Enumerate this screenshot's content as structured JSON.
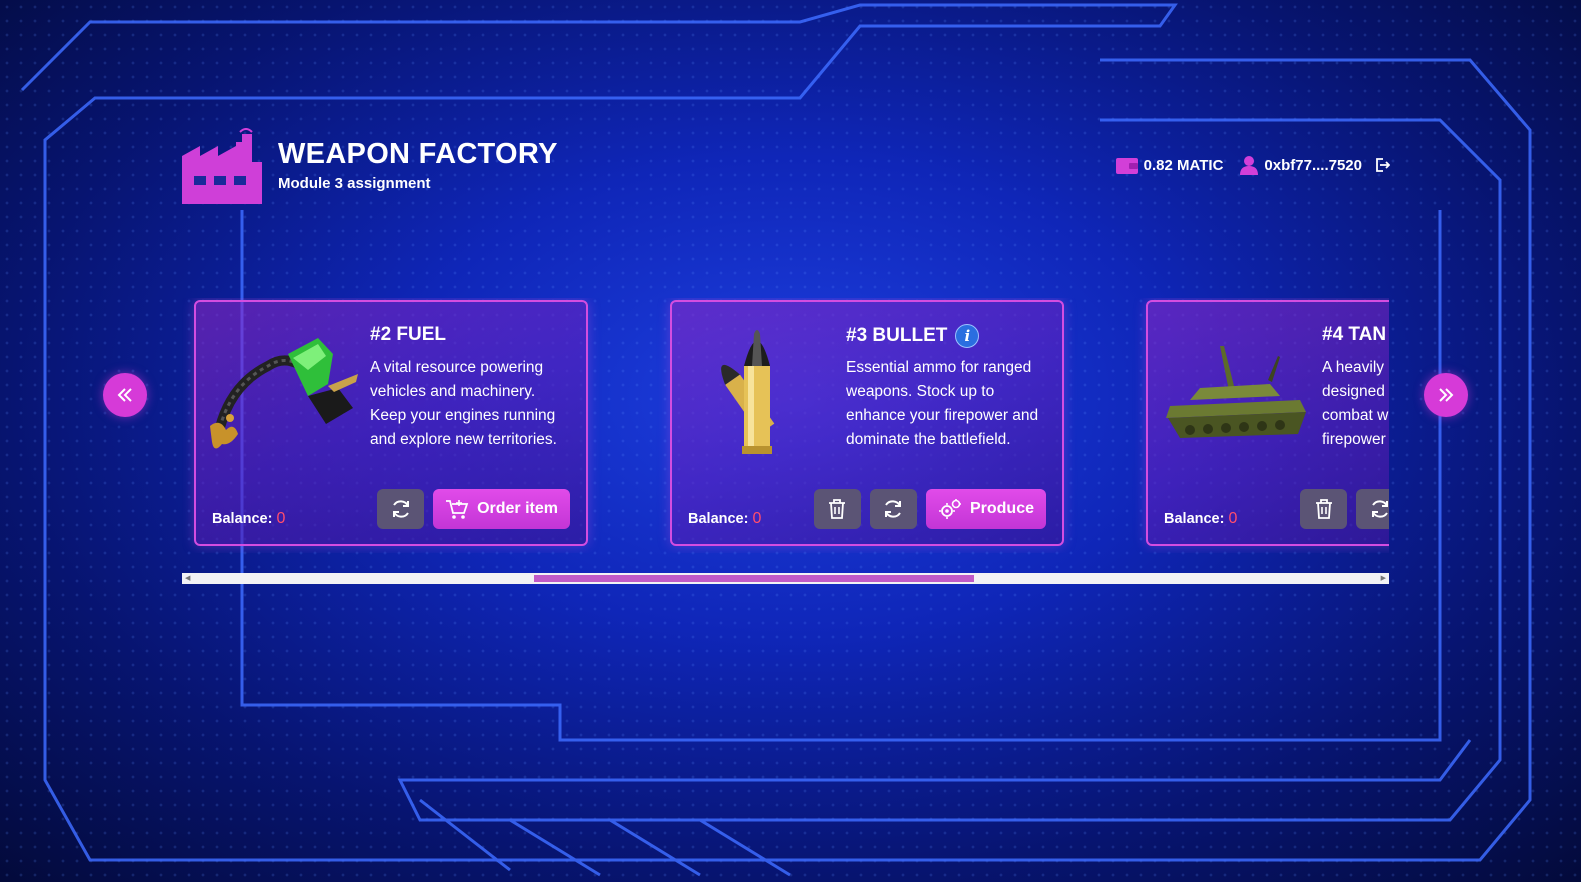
{
  "header": {
    "title": "WEAPON FACTORY",
    "subtitle": "Module 3 assignment",
    "logo_icon": "factory-icon"
  },
  "account": {
    "balance": "0.82 MATIC",
    "address": "0xbf77....7520",
    "wallet_icon": "wallet-icon",
    "user_icon": "user-icon",
    "logout_icon": "logout-icon"
  },
  "cards": [
    {
      "name": "#2 FUEL",
      "description": "A vital resource powering vehicles and machinery. Keep your engines running and explore new territories.",
      "balance_label": "Balance:",
      "balance_value": "0",
      "action_label": "Order item"
    },
    {
      "name": "#3 BULLET",
      "description": "Essential ammo for ranged weapons. Stock up to enhance your firepower and dominate the battlefield.",
      "balance_label": "Balance:",
      "balance_value": "0",
      "action_label": "Produce"
    },
    {
      "name": "#4 TAN",
      "description": "A heavily designed combat w firepower",
      "balance_label": "Balance:",
      "balance_value": "0"
    }
  ],
  "colors": {
    "accent": "#d63ad8",
    "balance_value": "#ff4d6d",
    "card_border": "#d44de0",
    "secondary_button": "#5b5475"
  },
  "scroll": {
    "position_fraction": 0.29,
    "visible_fraction": 0.36
  }
}
